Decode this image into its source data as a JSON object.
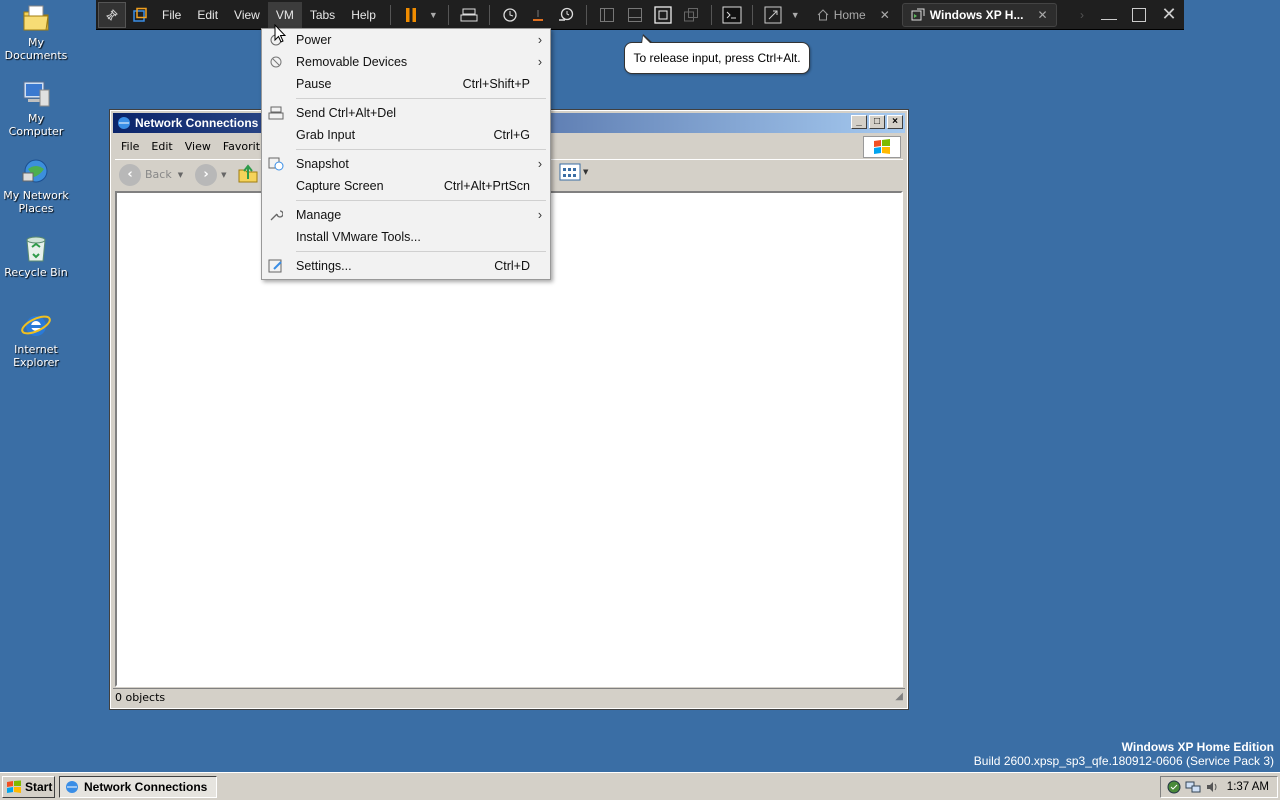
{
  "desktop": {
    "icons": [
      {
        "label": "My Documents"
      },
      {
        "label": "My Computer"
      },
      {
        "label": "My Network Places"
      },
      {
        "label": "Recycle Bin"
      },
      {
        "label": "Internet Explorer"
      }
    ]
  },
  "vmware": {
    "menus": [
      "File",
      "Edit",
      "View",
      "VM",
      "Tabs",
      "Help"
    ],
    "tabs": [
      {
        "label": "Home"
      },
      {
        "label": "Windows XP H..."
      }
    ]
  },
  "vm_menu": {
    "items": [
      {
        "label": "Power",
        "shortcut": "",
        "submenu": true
      },
      {
        "label": "Removable Devices",
        "shortcut": "",
        "submenu": true
      },
      {
        "label": "Pause",
        "shortcut": "Ctrl+Shift+P",
        "submenu": false
      },
      {
        "label": "Send Ctrl+Alt+Del",
        "shortcut": "",
        "submenu": false
      },
      {
        "label": "Grab Input",
        "shortcut": "Ctrl+G",
        "submenu": false
      },
      {
        "label": "Snapshot",
        "shortcut": "",
        "submenu": true
      },
      {
        "label": "Capture Screen",
        "shortcut": "Ctrl+Alt+PrtScn",
        "submenu": false
      },
      {
        "label": "Manage",
        "shortcut": "",
        "submenu": true
      },
      {
        "label": "Install VMware Tools...",
        "shortcut": "",
        "submenu": false
      },
      {
        "label": "Settings...",
        "shortcut": "Ctrl+D",
        "submenu": false
      }
    ]
  },
  "tooltip": {
    "text": "To release input, press Ctrl+Alt."
  },
  "explorer": {
    "title": "Network Connections",
    "menus": [
      "File",
      "Edit",
      "View",
      "Favorit"
    ],
    "back_label": "Back",
    "status": "0 objects"
  },
  "watermark": {
    "line1": "Windows XP Home Edition",
    "line2": "Build 2600.xpsp_sp3_qfe.180912-0606 (Service Pack 3)"
  },
  "taskbar": {
    "start_label": "Start",
    "task_label": "Network Connections",
    "clock": "1:37 AM"
  },
  "colors": {
    "desktop": "#3a6ea5",
    "vm_toolbar": "#1f1f1f",
    "pause_accent": "#f08c00"
  }
}
